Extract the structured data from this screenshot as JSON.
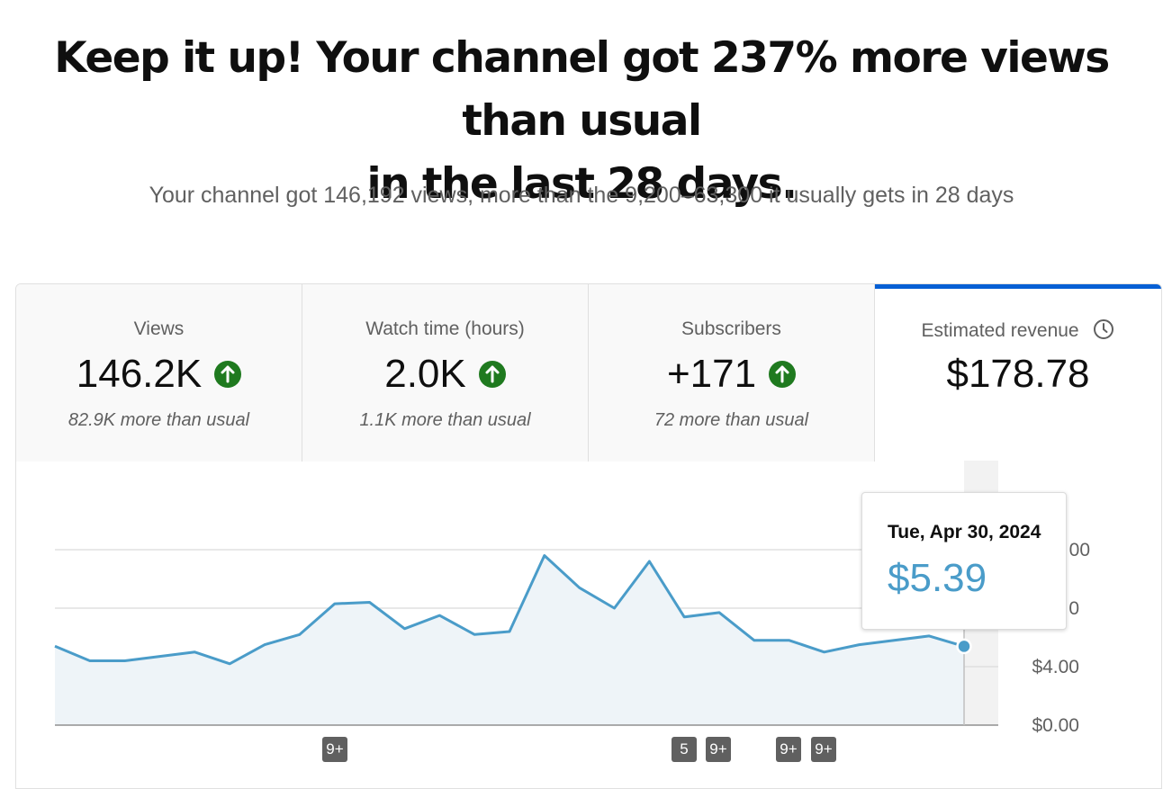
{
  "headline": {
    "line1": "Keep it up! Your channel got 237% more views than usual",
    "line2": "in the last 28 days."
  },
  "subline": "Your channel got 146,192 views, more than the 9,200–63,300 it usually gets in 28 days",
  "tabs": [
    {
      "label": "Views",
      "value": "146.2K",
      "note": "82.9K more than usual",
      "trend": "up-arrow-icon"
    },
    {
      "label": "Watch time (hours)",
      "value": "2.0K",
      "note": "1.1K more than usual",
      "trend": "up-arrow-icon"
    },
    {
      "label": "Subscribers",
      "value": "+171",
      "note": "72 more than usual",
      "trend": "up-arrow-icon"
    },
    {
      "label": "Estimated revenue",
      "value": "$178.78",
      "icon": "clock-icon"
    }
  ],
  "colors": {
    "accent": "#065fd4",
    "line": "#4a9cc9",
    "fill": "#eef4f8",
    "up": "#1f7a1f"
  },
  "tooltip": {
    "date": "Tue, Apr 30, 2024",
    "value": "$5.39"
  },
  "y_axis_labels": [
    "$0.00",
    "$4.00",
    "0",
    "00"
  ],
  "badges": [
    "9+",
    "5",
    "9+",
    "9+",
    "9+"
  ],
  "chart_data": {
    "type": "area",
    "xlabel": "",
    "ylabel": "",
    "ylim": [
      0,
      12
    ],
    "yticks": [
      0,
      4,
      8,
      12
    ],
    "grid": true,
    "series": [
      {
        "values": [
          5.4,
          4.4,
          4.4,
          4.7,
          5.0,
          4.2,
          5.5,
          6.2,
          8.3,
          8.4,
          6.6,
          7.5,
          6.2,
          6.4,
          11.6,
          9.4,
          8.0,
          11.2,
          7.4,
          7.7,
          5.8,
          5.8,
          5.0,
          5.5,
          5.8,
          6.1,
          5.39
        ]
      }
    ]
  }
}
